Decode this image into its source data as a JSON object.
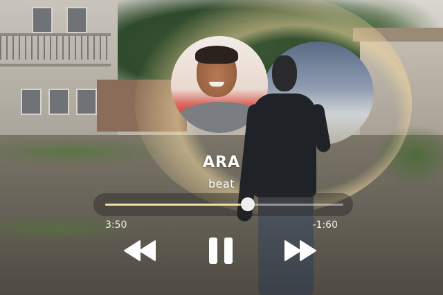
{
  "track": {
    "title": "ARA",
    "artist": "beat"
  },
  "playback": {
    "elapsed": "3:50",
    "remaining": "-1:60",
    "progress": 0.598
  },
  "controls": {
    "rewind_icon": "rewind-icon",
    "pause_icon": "pause-icon",
    "forward_icon": "fast-forward-icon"
  },
  "colors": {
    "progress_fill": "#f1e29b",
    "text": "#ffffff",
    "knob": "#eeeeee"
  }
}
